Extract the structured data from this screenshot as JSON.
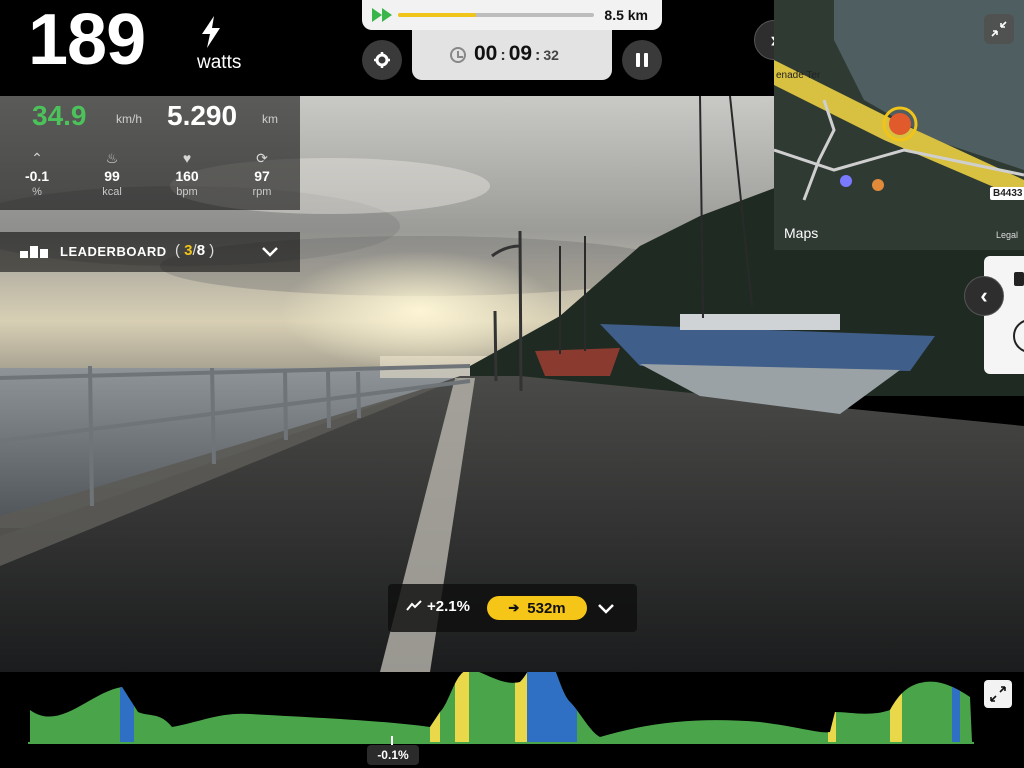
{
  "power": {
    "value": "189",
    "unit": "watts"
  },
  "progress": {
    "total_distance": "8.5 km",
    "completed_fraction": 0.4
  },
  "timer": {
    "hours": "00",
    "minutes": "09",
    "seconds": "32"
  },
  "metrics": {
    "speed": {
      "value": "34.9",
      "unit": "km/h"
    },
    "distance": {
      "value": "5.290",
      "unit": "km"
    },
    "items": [
      {
        "icon": "gradient-icon",
        "value": "-0.1",
        "unit": "%"
      },
      {
        "icon": "flame-icon",
        "value": "99",
        "unit": "kcal"
      },
      {
        "icon": "heart-icon",
        "value": "160",
        "unit": "bpm"
      },
      {
        "icon": "cadence-icon",
        "value": "97",
        "unit": "rpm"
      }
    ]
  },
  "leaderboard": {
    "label": "LEADERBOARD",
    "position": "3",
    "total": "8"
  },
  "map": {
    "provider": "Maps",
    "road_label": "B4433",
    "street_label": "enade Ter",
    "legal": "Legal"
  },
  "gradient_pill": {
    "grade": "+2.1%",
    "distance": "532m"
  },
  "profile": {
    "current_grade": "-0.1%"
  },
  "colors": {
    "accent_yellow": "#f5c518",
    "speed_green": "#4cc25a",
    "profile_green": "#4aa54a",
    "profile_blue": "#2f6fc4",
    "profile_yellow": "#e8d84a"
  }
}
